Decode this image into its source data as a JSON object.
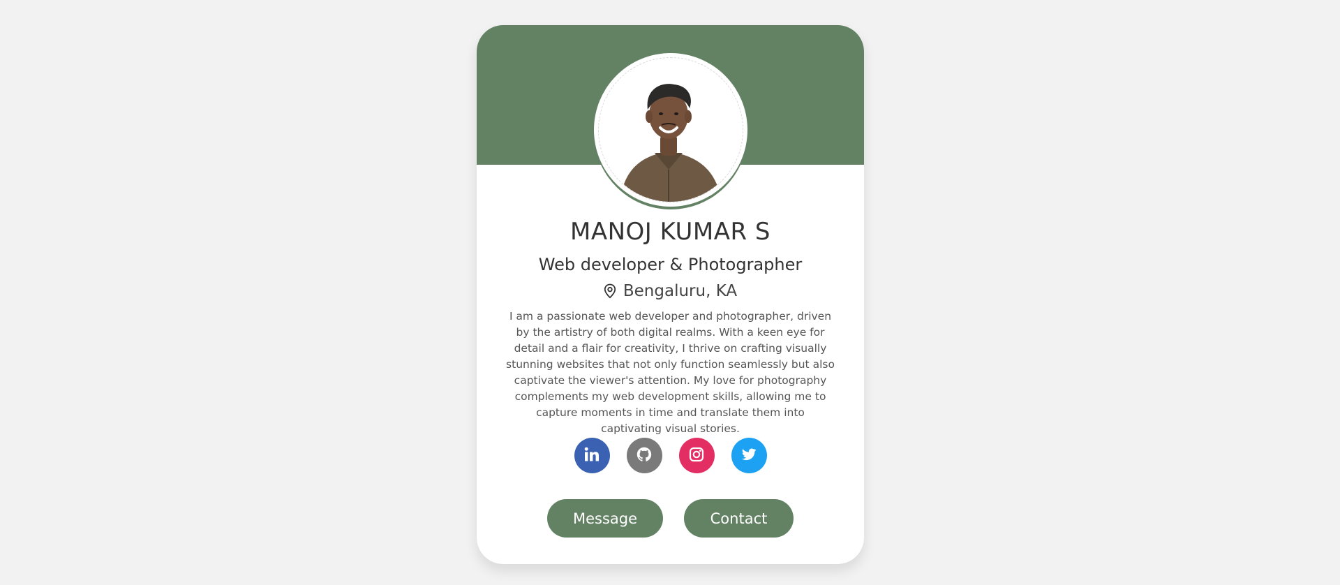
{
  "colors": {
    "accent": "#638264",
    "page_bg": "#f2f2f2",
    "card_bg": "#ffffff",
    "linkedin": "#3b62b2",
    "github": "#7a7a7a",
    "instagram": "#e32e64",
    "twitter": "#1da1f2"
  },
  "profile": {
    "name": "MANOJ KUMAR S",
    "role": "Web developer & Photographer",
    "location": "Bengaluru, KA",
    "bio": "I am a passionate web developer and photographer, driven by the artistry of both digital realms. With a keen eye for detail and a flair for creativity, I thrive on crafting visually stunning websites that not only function seamlessly but also captivate the viewer's attention. My love for photography complements my web development skills, allowing me to capture moments in time and translate them into captivating visual stories."
  },
  "socials": [
    {
      "icon": "linkedin-icon"
    },
    {
      "icon": "github-icon"
    },
    {
      "icon": "instagram-icon"
    },
    {
      "icon": "twitter-icon"
    }
  ],
  "actions": {
    "message_label": "Message",
    "contact_label": "Contact"
  }
}
